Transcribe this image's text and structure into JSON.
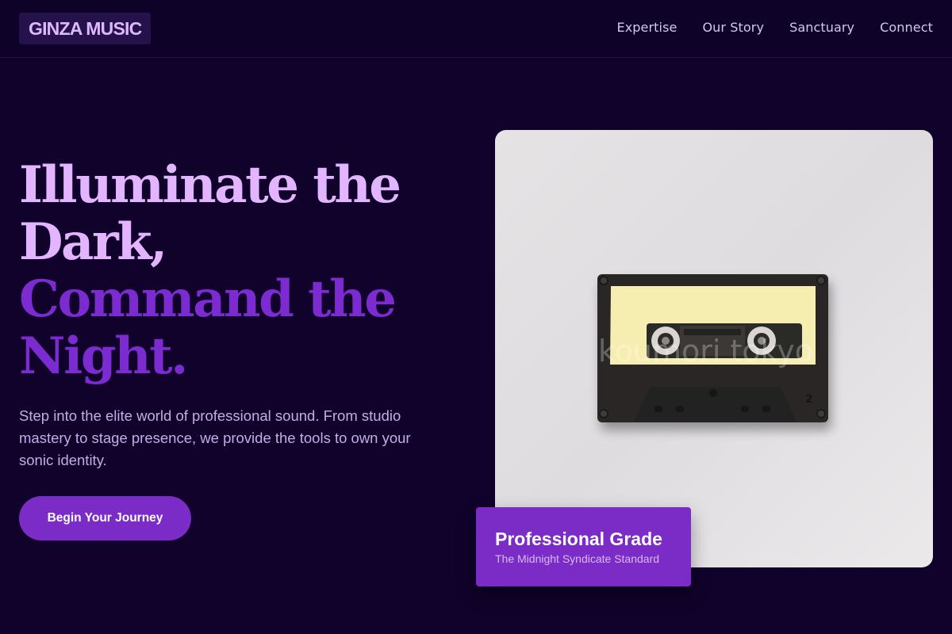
{
  "header": {
    "logo": "GINZA MUSIC",
    "nav": [
      {
        "label": "Expertise"
      },
      {
        "label": "Our Story"
      },
      {
        "label": "Sanctuary"
      },
      {
        "label": "Connect"
      }
    ]
  },
  "hero": {
    "title_line1": "Illuminate the",
    "title_line2": "Dark,",
    "title_line3": "Command the",
    "title_line4": "Night.",
    "description": "Step into the elite world of professional sound. From studio mastery to stage presence, we provide the tools to own your sonic identity.",
    "cta_label": "Begin Your Journey"
  },
  "image": {
    "watermark": "koumori tokyo",
    "cassette_side": "2"
  },
  "badge": {
    "title": "Professional Grade",
    "subtitle": "The Midnight Syndicate Standard"
  },
  "colors": {
    "background": "#10022a",
    "accent": "#7b2bc6",
    "title_light": "#e3b4ff",
    "title_dark": "#7b2bd0"
  }
}
